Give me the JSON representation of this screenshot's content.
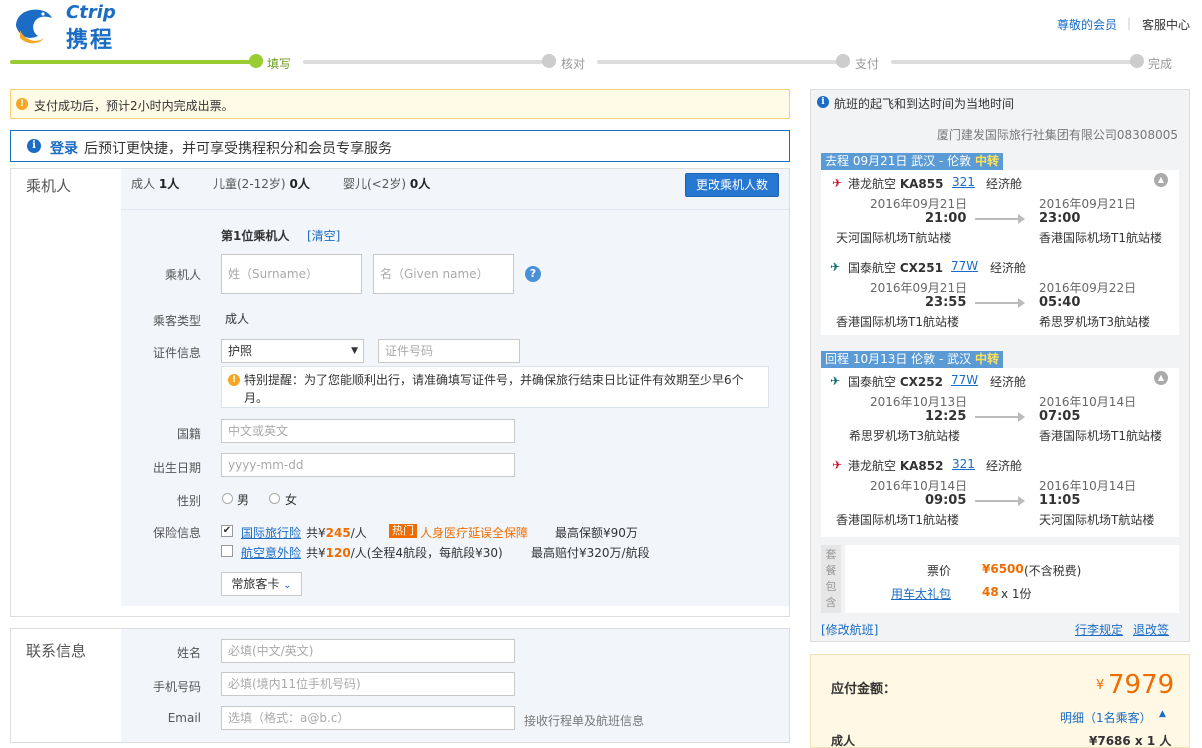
{
  "header": {
    "brand_en": "Ctrip",
    "brand_cn": "携程",
    "member_link": "尊敬的会员",
    "sep": "|",
    "service_link": "客服中心",
    "colors": {
      "brand": "#1a6cc4",
      "accent": "#f06c00",
      "progress": "#9acd32"
    }
  },
  "progress": {
    "steps": [
      {
        "label": "填写",
        "done": true
      },
      {
        "label": "核对",
        "done": false
      },
      {
        "label": "支付",
        "done": false
      },
      {
        "label": "完成",
        "done": false
      }
    ]
  },
  "notice": {
    "text": "支付成功后，预计2小时内完成出票。"
  },
  "login_bar": {
    "login_link": "登录",
    "text": "后预订更快捷，并可享受携程积分和会员专享服务"
  },
  "passenger": {
    "section_title": "乘机人",
    "counts": {
      "adult_label": "成人",
      "adult_value": "1人",
      "child_label": "儿童(2-12岁)",
      "child_value": "0人",
      "infant_label": "婴儿(<2岁)",
      "infant_value": "0人"
    },
    "change_button": "更改乘机人数",
    "form_title": "第1位乘机人",
    "clear_link": "[清空]",
    "name_label": "乘机人",
    "surname_placeholder": "姓（Surname）",
    "given_placeholder": "名（Given name）",
    "help_icon": "?",
    "type_label": "乘客类型",
    "type_value": "成人",
    "id_label": "证件信息",
    "id_type_value": "护照",
    "id_number_placeholder": "证件号码",
    "id_tip": "特别提醒：为了您能顺利出行，请准确填写证件号，并确保旅行结束日比证件有效期至少早6个月。",
    "nationality_label": "国籍",
    "nationality_placeholder": "中文或英文",
    "birth_label": "出生日期",
    "birth_placeholder": "yyyy-mm-dd",
    "gender_label": "性别",
    "gender_male": "男",
    "gender_female": "女",
    "insurance_label": "保险信息",
    "insurance": [
      {
        "checked": true,
        "name": "国际旅行险",
        "price_prefix": "共¥",
        "price": "245",
        "price_suffix": "/人",
        "hot_badge": "热门",
        "hot_text": "人身医疗延误全保障",
        "max_text": "最高保额¥90万"
      },
      {
        "checked": false,
        "name": "航空意外险",
        "price_prefix": "共¥",
        "price": "120",
        "price_suffix": "/人(全程4航段，每航段¥30)",
        "max_text": "最高赔付¥320万/航段"
      }
    ],
    "frequent_flyer_button": "常旅客卡"
  },
  "contact": {
    "section_title": "联系信息",
    "name_label": "姓名",
    "name_placeholder": "必填(中文/英文)",
    "phone_label": "手机号码",
    "phone_placeholder": "必填(境内11位手机号码)",
    "email_label": "Email",
    "email_placeholder": "选填（格式：a@b.c）",
    "email_hint": "接收行程单及航班信息"
  },
  "flights": {
    "notice": "航班的起飞和到达时间为当地时间",
    "agency": "厦门建发国际旅行社集团有限公司08308005",
    "outbound": {
      "head": "去程 09月21日 武汉 - 伦敦",
      "transfer": "中转",
      "legs": [
        {
          "airline": "港龙航空",
          "flight_no": "KA855",
          "aircraft": "321",
          "cabin": "经济舱",
          "dep_date": "2016年09月21日",
          "dep_time": "21:00",
          "dep_airport": "天河国际机场T航站楼",
          "arr_date": "2016年09月21日",
          "arr_time": "23:00",
          "arr_airport": "香港国际机场T1航站楼"
        },
        {
          "airline": "国泰航空",
          "flight_no": "CX251",
          "aircraft": "77W",
          "cabin": "经济舱",
          "dep_date": "2016年09月21日",
          "dep_time": "23:55",
          "dep_airport": "香港国际机场T1航站楼",
          "arr_date": "2016年09月22日",
          "arr_time": "05:40",
          "arr_airport": "希思罗机场T3航站楼"
        }
      ]
    },
    "return": {
      "head": "回程 10月13日 伦敦 - 武汉",
      "transfer": "中转",
      "legs": [
        {
          "airline": "国泰航空",
          "flight_no": "CX252",
          "aircraft": "77W",
          "cabin": "经济舱",
          "dep_date": "2016年10月13日",
          "dep_time": "12:25",
          "dep_airport": "希思罗机场T3航站楼",
          "arr_date": "2016年10月14日",
          "arr_time": "07:05",
          "arr_airport": "香港国际机场T1航站楼"
        },
        {
          "airline": "港龙航空",
          "flight_no": "KA852",
          "aircraft": "321",
          "cabin": "经济舱",
          "dep_date": "2016年10月14日",
          "dep_time": "09:05",
          "dep_airport": "香港国际机场T1航站楼",
          "arr_date": "2016年10月14日",
          "arr_time": "11:05",
          "arr_airport": "天河国际机场T航站楼"
        }
      ]
    },
    "package": {
      "side_label": "套餐包含",
      "ticket_label": "票价",
      "ticket_price": "¥6500",
      "ticket_note": "(不含税费)",
      "gift_link": "用车太礼包",
      "gift_price": "48",
      "gift_qty": "x 1份"
    },
    "modify_link": "[修改航班]",
    "baggage_link": "行李规定",
    "refund_link": "退改签"
  },
  "payment": {
    "label": "应付金额：",
    "currency": "¥",
    "total": "7979",
    "detail_link": "明细（1名乘客）",
    "adult_label": "成人",
    "adult_price": "¥7686 x 1 人"
  }
}
